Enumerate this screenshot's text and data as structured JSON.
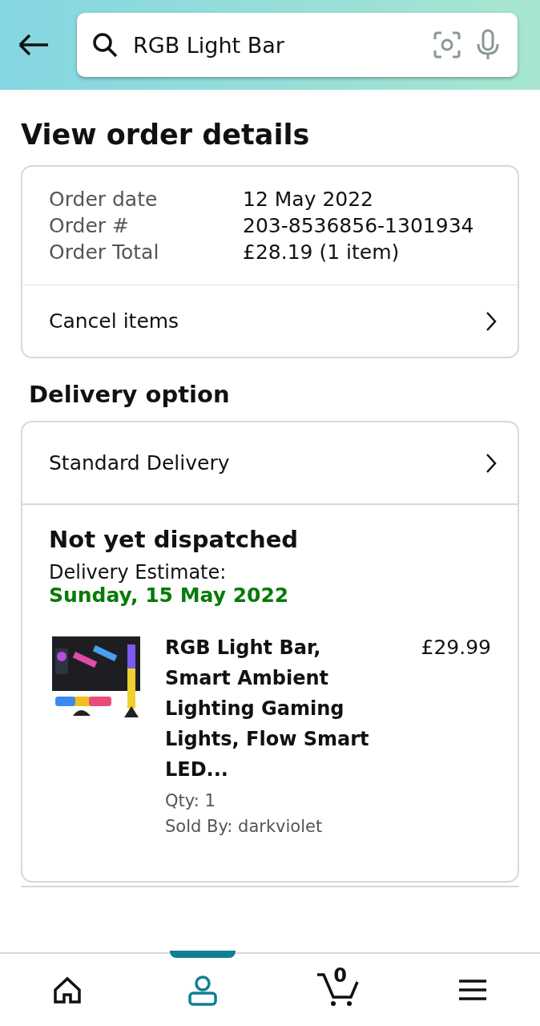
{
  "search": {
    "value": "RGB Light Bar"
  },
  "title": "View order details",
  "order": {
    "rows": [
      {
        "label": "Order date",
        "value": "12 May 2022"
      },
      {
        "label": "Order #",
        "value": "203-8536856-1301934"
      },
      {
        "label": "Order Total",
        "value": "£28.19 (1 item)"
      }
    ],
    "action": "Cancel items"
  },
  "delivery": {
    "heading": "Delivery option",
    "option": "Standard Delivery",
    "status": "Not yet dispatched",
    "estimate_label": "Delivery Estimate:",
    "estimate_date": "Sunday, 15 May 2022",
    "item": {
      "name": "RGB Light Bar, Smart Ambient Lighting Gaming Lights, Flow Smart LED...",
      "price": "£29.99",
      "qty": "Qty: 1",
      "seller": "Sold By: darkviolet"
    }
  },
  "nav": [
    {
      "kind": "home",
      "selected": false
    },
    {
      "kind": "account",
      "selected": true
    },
    {
      "kind": "cart",
      "selected": false,
      "count": "0"
    },
    {
      "kind": "menu",
      "selected": false
    }
  ]
}
